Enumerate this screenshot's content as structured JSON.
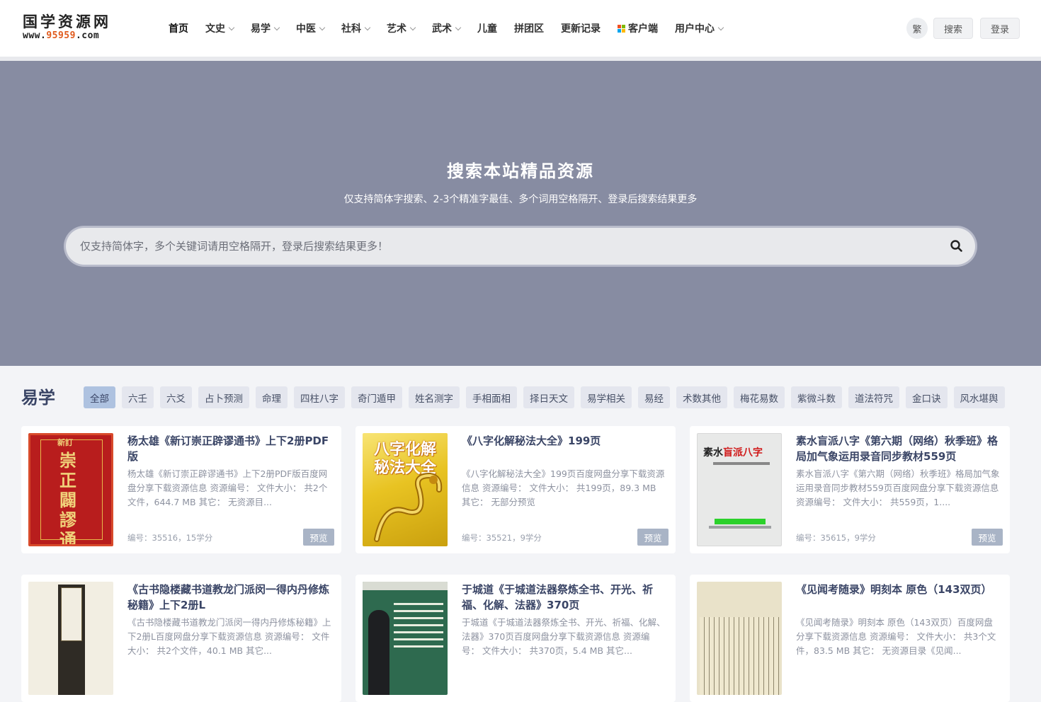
{
  "logo": {
    "text": "国学资源网",
    "url_prefix": "www.",
    "url_highlight": "95959",
    "url_suffix": ".com"
  },
  "nav": [
    {
      "label": "首页",
      "dropdown": false
    },
    {
      "label": "文史",
      "dropdown": true
    },
    {
      "label": "易学",
      "dropdown": true
    },
    {
      "label": "中医",
      "dropdown": true
    },
    {
      "label": "社科",
      "dropdown": true
    },
    {
      "label": "艺术",
      "dropdown": true
    },
    {
      "label": "武术",
      "dropdown": true
    },
    {
      "label": "儿童",
      "dropdown": false
    },
    {
      "label": "拼团区",
      "dropdown": false
    },
    {
      "label": "更新记录",
      "dropdown": false
    },
    {
      "label": "客户端",
      "dropdown": false
    },
    {
      "label": "用户中心",
      "dropdown": true
    }
  ],
  "header_buttons": {
    "traditional": "繁",
    "search": "搜索",
    "login": "登录"
  },
  "hero": {
    "title": "搜索本站精品资源",
    "subtitle": "仅支持简体字搜索、2-3个精准字最佳、多个词用空格隔开、登录后搜索结果更多",
    "search_placeholder": "仅支持简体字，多个关键词请用空格隔开，登录后搜索结果更多！"
  },
  "section": {
    "title": "易学",
    "tags": [
      "全部",
      "六壬",
      "六爻",
      "占卜预测",
      "命理",
      "四柱八字",
      "奇门遁甲",
      "姓名测字",
      "手相面相",
      "择日天文",
      "易学相关",
      "易经",
      "术数其他",
      "梅花易数",
      "紫微斗数",
      "道法符咒",
      "金口诀",
      "风水堪舆"
    ],
    "active_tag": "全部"
  },
  "cards": [
    {
      "title": "杨太雄《新订崇正辟谬通书》上下2册PDF版",
      "desc": "杨太雄《新订崇正辟谬通书》上下2册PDF版百度网盘分享下载资源信息 资源编号： 文件大小： 共2个文件，644.7 MB 其它： 无资源目...",
      "meta": "编号：35516，15学分",
      "preview": "预览",
      "thumb_big": "崇正闢謬通書",
      "thumb_small": "新訂"
    },
    {
      "title": "《八字化解秘法大全》199页",
      "desc": "《八字化解秘法大全》199页百度网盘分享下载资源信息 资源编号： 文件大小： 共199页，89.3 MB 其它： 无部分预览",
      "meta": "编号：35521，9学分",
      "preview": "预览",
      "thumb_text": "八字化解秘法大全"
    },
    {
      "title": "素水盲派八字《第六期（网络）秋季班》格局加气象运用录音同步教材559页",
      "desc": "素水盲派八字《第六期（网络）秋季班》格局加气象运用录音同步教材559页百度网盘分享下载资源信息 资源编号： 文件大小： 共559页，1....",
      "meta": "编号：35615，9学分",
      "preview": "预览",
      "thumb_head_a": "素水",
      "thumb_head_b": "盲派八字"
    },
    {
      "title": "《古书隐楼藏书道教龙门派闵一得内丹修炼秘籍》上下2册L",
      "desc": "《古书隐楼藏书道教龙门派闵一得内丹修炼秘籍》上下2册L百度网盘分享下载资源信息 资源编号： 文件大小： 共2个文件，40.1 MB 其它...",
      "meta": "",
      "preview": "预览"
    },
    {
      "title": "于城道《于城道法器祭炼全书、开光、祈福、化解、法器》370页",
      "desc": "于城道《于城道法器祭炼全书、开光、祈福、化解、法器》370页百度网盘分享下载资源信息 资源编号： 文件大小： 共370页，5.4 MB 其它...",
      "meta": "",
      "preview": "预览"
    },
    {
      "title": "《见闻考随录》明刻本 原色（143双页）",
      "desc": "《见闻考随录》明刻本 原色（143双页）百度网盘分享下载资源信息 资源编号： 文件大小： 共3个文件，83.5 MB 其它： 无资源目录《见闻...",
      "meta": "",
      "preview": "预览"
    }
  ],
  "colors": {
    "hero_bg": "#878ca2",
    "title_text": "#3a4566",
    "tag_bg": "#e4e6ee",
    "tag_active_bg": "#aec2e0",
    "preview_bg": "#a9b4c6",
    "page_bg": "#f3f4f7"
  }
}
